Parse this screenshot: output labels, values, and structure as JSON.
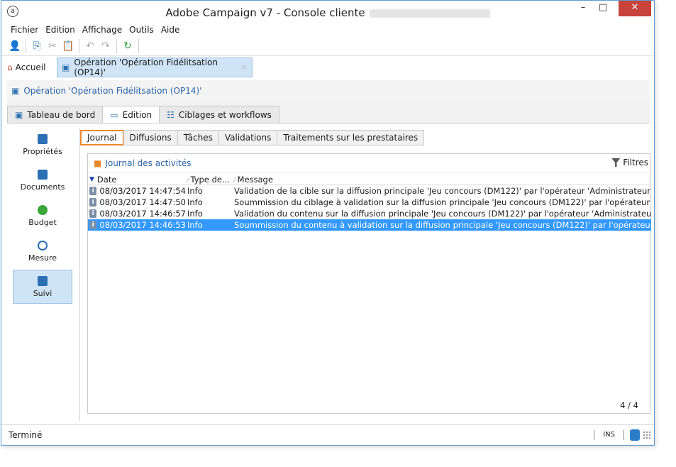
{
  "window": {
    "title": "Adobe Campaign v7 - Console cliente",
    "minimize": "–",
    "maximize": "□",
    "close": "✕"
  },
  "menu": [
    "Fichier",
    "Edition",
    "Affichage",
    "Outils",
    "Aide"
  ],
  "doc_tabs": {
    "home_label": "Accueil",
    "operation_label": "Opération 'Opération Fidélitsation (OP14)'"
  },
  "operation_header": "Opération 'Opération Fidélitsation (OP14)'",
  "main_tabs": [
    "Tableau de bord",
    "Edition",
    "Ciblages et workflows"
  ],
  "sidebar": [
    {
      "label": "Propriétés",
      "color": "#2d6fb3"
    },
    {
      "label": "Documents",
      "color": "#2d6fb3"
    },
    {
      "label": "Budget",
      "color": "#3aa63a"
    },
    {
      "label": "Mesure",
      "color": "#2d6fb3"
    },
    {
      "label": "Suivi",
      "color": "#2d6fb3"
    }
  ],
  "sub_tabs": [
    "Journal",
    "Diffusions",
    "Tâches",
    "Validations",
    "Traitements sur les prestataires"
  ],
  "journal": {
    "title": "Journal des activités",
    "filters_label": "Filtres",
    "columns": [
      "Date",
      "Type de...",
      "Message"
    ],
    "rows": [
      {
        "date": "08/03/2017 14:47:54",
        "type": "Info",
        "message": "Validation de la cible sur la diffusion principale 'Jeu concours (DM122)' par l'opérateur 'Administrateur (admin)'"
      },
      {
        "date": "08/03/2017 14:47:50",
        "type": "Info",
        "message": "Soummission du ciblage à validation sur la diffusion principale 'Jeu concours (DM122)' par l'opérateur 'Administrateur (admin)'"
      },
      {
        "date": "08/03/2017 14:46:57",
        "type": "Info",
        "message": "Validation du contenu sur la diffusion principale 'Jeu concours (DM122)' par l'opérateur 'Administrateur (admin)'"
      },
      {
        "date": "08/03/2017 14:46:53",
        "type": "Info",
        "message": "Soummission du contenu à validation sur la diffusion principale 'Jeu concours (DM122)' par l'opérateur 'Administrateur (admin)'"
      }
    ],
    "count": "4 / 4"
  },
  "status": {
    "text": "Terminé",
    "ins": "INS"
  },
  "colors": {
    "accent": "#2a64a8",
    "selection": "#3399ff",
    "active_tab_border": "#e8892c",
    "close_button": "#c7433b"
  }
}
